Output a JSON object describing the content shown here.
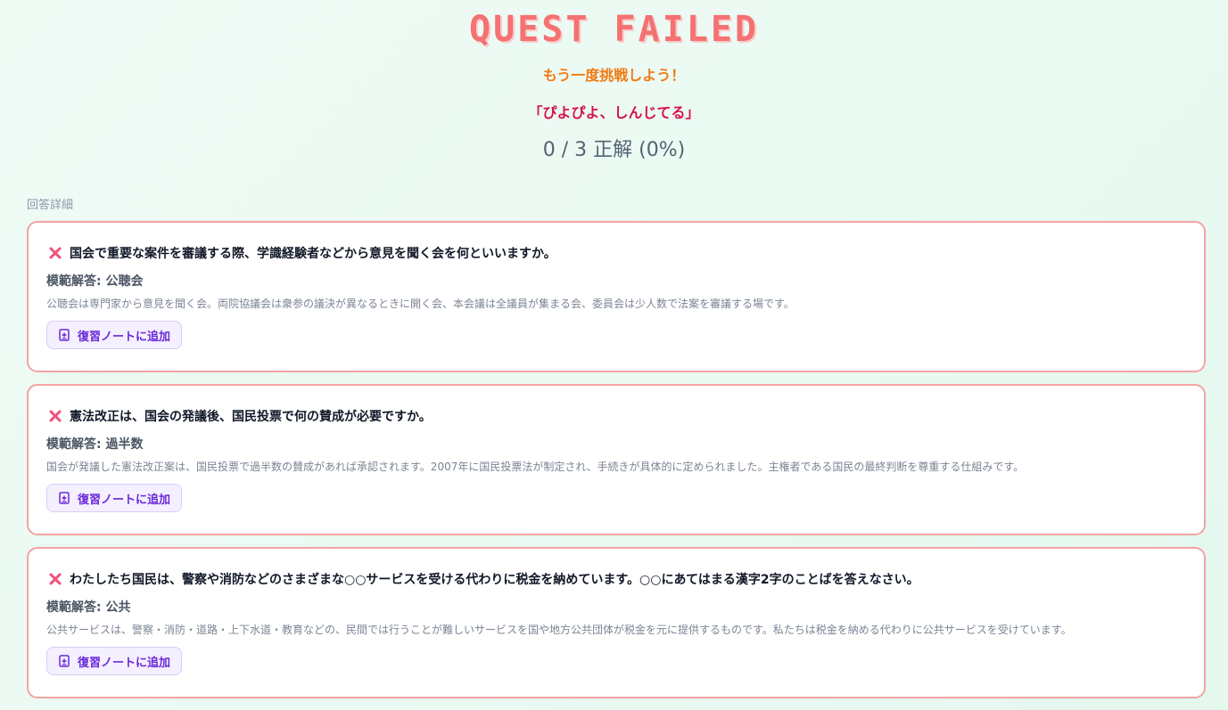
{
  "header": {
    "title": "QUEST FAILED",
    "retry_message": "もう一度挑戦しよう！",
    "quote": "「ぴよぴよ、しんじてる」",
    "score": "0 / 3 正解 (0%)"
  },
  "section_label": "回答詳細",
  "colors": {
    "title": "#f47272",
    "retry": "#f07b12",
    "quote": "#d6114f",
    "card_border": "#f4a3a3",
    "wrong_icon": "#f0507a",
    "button_text": "#6a28d8"
  },
  "answers": [
    {
      "status_icon": "cross-icon",
      "question": "国会で重要な案件を審議する際、学識経験者などから意見を聞く会を何といいますか。",
      "model_answer": "模範解答: 公聴会",
      "explanation": "公聴会は専門家から意見を聞く会。両院協議会は衆参の議決が異なるときに開く会、本会議は全議員が集まる会、委員会は少人数で法案を審議する場です。",
      "button_label": "復習ノートに追加"
    },
    {
      "status_icon": "cross-icon",
      "question": "憲法改正は、国会の発議後、国民投票で何の賛成が必要ですか。",
      "model_answer": "模範解答: 過半数",
      "explanation": "国会が発議した憲法改正案は、国民投票で過半数の賛成があれば承認されます。2007年に国民投票法が制定され、手続きが具体的に定められました。主権者である国民の最終判断を尊重する仕組みです。",
      "button_label": "復習ノートに追加"
    },
    {
      "status_icon": "cross-icon",
      "question": "わたしたち国民は、警察や消防などのさまざまな○○サービスを受ける代わりに税金を納めています。○○にあてはまる漢字2字のことばを答えなさい。",
      "model_answer": "模範解答: 公共",
      "explanation": "公共サービスは、警察・消防・道路・上下水道・教育などの、民間では行うことが難しいサービスを国や地方公共団体が税金を元に提供するものです。私たちは税金を納める代わりに公共サービスを受けています。",
      "button_label": "復習ノートに追加"
    }
  ]
}
